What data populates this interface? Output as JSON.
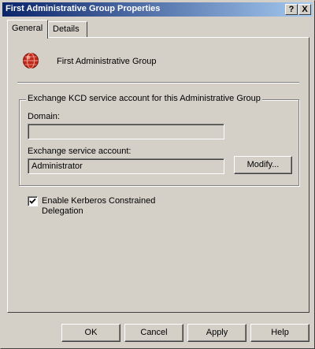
{
  "window": {
    "title": "First Administrative Group Properties",
    "help_button": "?",
    "close_button": "X"
  },
  "tabs": [
    {
      "label": "General",
      "active": true
    },
    {
      "label": "Details",
      "active": false
    }
  ],
  "general": {
    "icon": "exchange-admin-group-icon",
    "name": "First Administrative Group",
    "groupbox_title": "Exchange KCD service account for this Administrative Group",
    "domain_label": "Domain:",
    "domain_value": "",
    "account_label": "Exchange service account:",
    "account_value": "Administrator",
    "modify_label": "Modify...",
    "checkbox_checked": true,
    "checkbox_label_line1": "Enable Kerberos Constrained",
    "checkbox_label_line2": "Delegation"
  },
  "buttons": {
    "ok": "OK",
    "cancel": "Cancel",
    "apply": "Apply",
    "help": "Help"
  },
  "colors": {
    "titlebar_start": "#0a246a",
    "titlebar_end": "#a6caf0",
    "face": "#d4d0c8",
    "icon_red": "#c0281c"
  }
}
